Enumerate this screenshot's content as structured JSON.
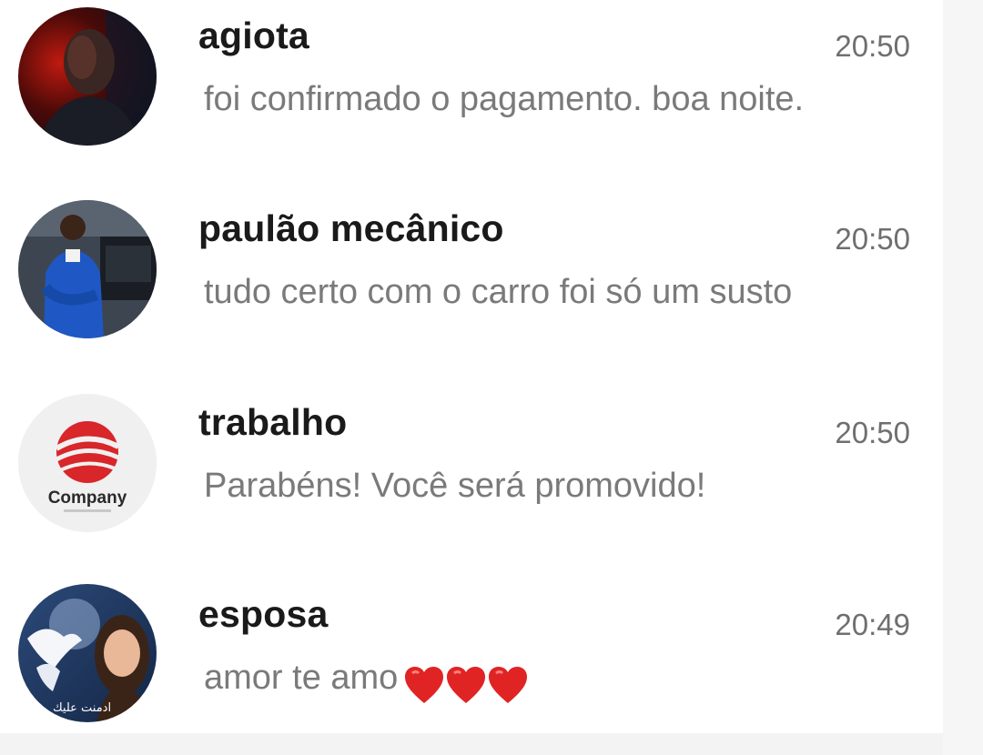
{
  "colors": {
    "background": "#ffffff",
    "name_text": "#1a1a1a",
    "preview_text": "#7a7a7a",
    "time_text": "#6f6f6f",
    "heart": "#e02424"
  },
  "chats": [
    {
      "name": "agiota",
      "time": "20:50",
      "preview": "foi confirmado o pagamento. boa noite.",
      "avatar": "man-dark-red-portrait"
    },
    {
      "name": "paulão mecânico",
      "time": "20:50",
      "preview": "tudo certo com o carro foi só um susto",
      "avatar": "mechanic-in-blue-overalls"
    },
    {
      "name": "trabalho",
      "time": "20:50",
      "preview": "Parabéns! Você será promovido!",
      "avatar": "company-logo",
      "avatar_text": "Company"
    },
    {
      "name": "esposa",
      "time": "20:49",
      "preview": "amor te amo",
      "preview_emoji": [
        "red-heart-icon",
        "red-heart-icon",
        "red-heart-icon"
      ],
      "avatar": "woman-with-dove",
      "avatar_text": "ادمنت عليك"
    }
  ]
}
